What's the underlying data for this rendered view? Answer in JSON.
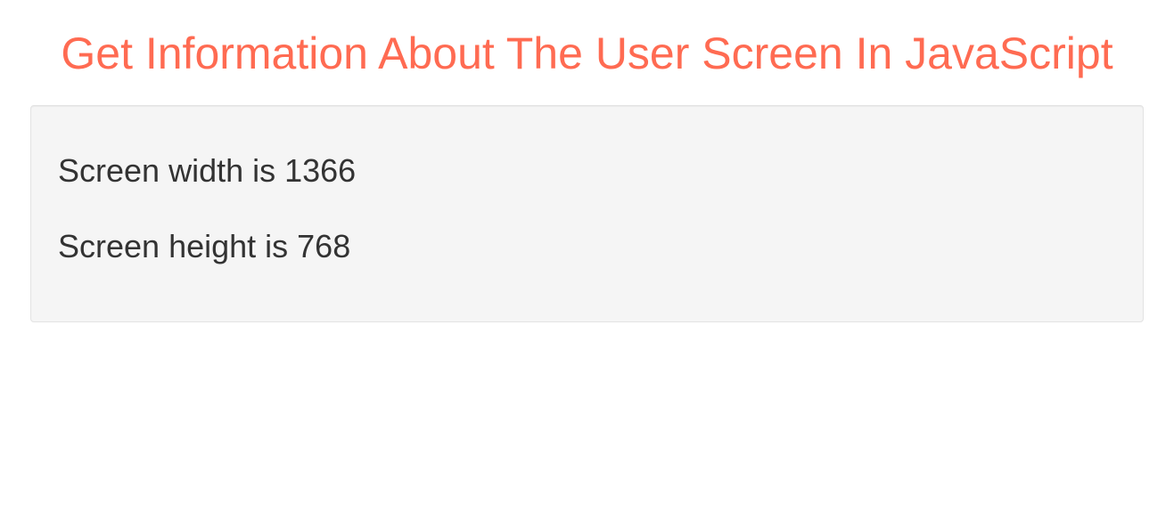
{
  "header": {
    "title": "Get Information About The User Screen In JavaScript"
  },
  "info": {
    "width_line": "Screen width is 1366",
    "height_line": "Screen height is 768"
  }
}
